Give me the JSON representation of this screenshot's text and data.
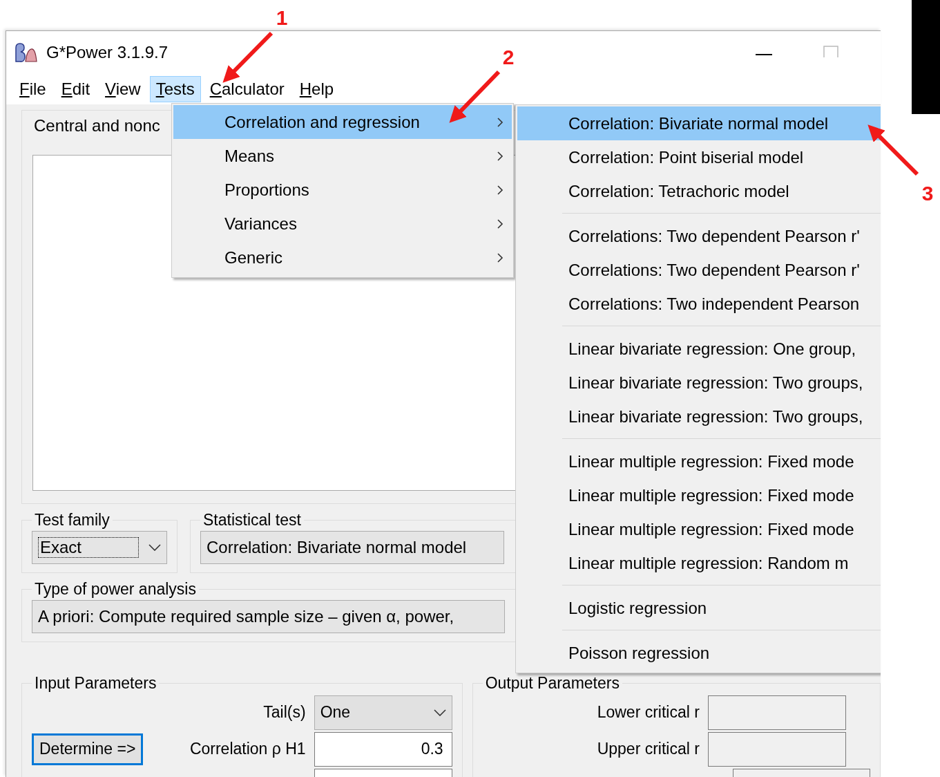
{
  "window": {
    "title": "G*Power 3.1.9.7"
  },
  "menubar": [
    {
      "label": "File",
      "selected": false
    },
    {
      "label": "Edit",
      "selected": false
    },
    {
      "label": "View",
      "selected": false
    },
    {
      "label": "Tests",
      "selected": true
    },
    {
      "label": "Calculator",
      "selected": false
    },
    {
      "label": "Help",
      "selected": false
    }
  ],
  "tests_menu": [
    {
      "label": "Correlation and regression",
      "selected": true
    },
    {
      "label": "Means",
      "selected": false
    },
    {
      "label": "Proportions",
      "selected": false
    },
    {
      "label": "Variances",
      "selected": false
    },
    {
      "label": "Generic",
      "selected": false
    }
  ],
  "submenu_groups": [
    [
      {
        "label": "Correlation: Bivariate normal model",
        "selected": true
      },
      {
        "label": "Correlation: Point biserial model",
        "selected": false
      },
      {
        "label": "Correlation: Tetrachoric model",
        "selected": false
      }
    ],
    [
      {
        "label": "Correlations: Two dependent Pearson r'",
        "selected": false
      },
      {
        "label": "Correlations: Two dependent Pearson r'",
        "selected": false
      },
      {
        "label": "Correlations: Two independent Pearson",
        "selected": false
      }
    ],
    [
      {
        "label": "Linear bivariate regression: One group,",
        "selected": false
      },
      {
        "label": "Linear bivariate regression: Two groups,",
        "selected": false
      },
      {
        "label": "Linear bivariate regression: Two groups,",
        "selected": false
      }
    ],
    [
      {
        "label": "Linear multiple regression: Fixed mode",
        "selected": false
      },
      {
        "label": "Linear multiple regression: Fixed mode",
        "selected": false
      },
      {
        "label": "Linear multiple regression: Fixed mode",
        "selected": false
      },
      {
        "label": "Linear multiple regression: Random m",
        "selected": false
      }
    ],
    [
      {
        "label": "Logistic regression",
        "selected": false
      }
    ],
    [
      {
        "label": "Poisson regression",
        "selected": false
      }
    ]
  ],
  "distribution_panel": {
    "title": "Central and nonc"
  },
  "test_family": {
    "label": "Test family",
    "value": "Exact"
  },
  "statistical_test": {
    "label": "Statistical test",
    "value": "Correlation: Bivariate normal model"
  },
  "power_analysis": {
    "label": "Type of power analysis",
    "value": "A priori: Compute required sample size – given α, power,"
  },
  "input_parameters": {
    "title": "Input Parameters",
    "determine_button": "Determine =>",
    "fields": [
      {
        "label": "Tail(s)",
        "value": "One",
        "kind": "select"
      },
      {
        "label": "Correlation ρ H1",
        "value": "0.3",
        "kind": "text"
      }
    ]
  },
  "output_parameters": {
    "title": "Output Parameters",
    "fields": [
      {
        "label": "Lower critical r"
      },
      {
        "label": "Upper critical r"
      }
    ]
  },
  "annotations": [
    {
      "label": "1"
    },
    {
      "label": "2"
    },
    {
      "label": "3"
    }
  ]
}
